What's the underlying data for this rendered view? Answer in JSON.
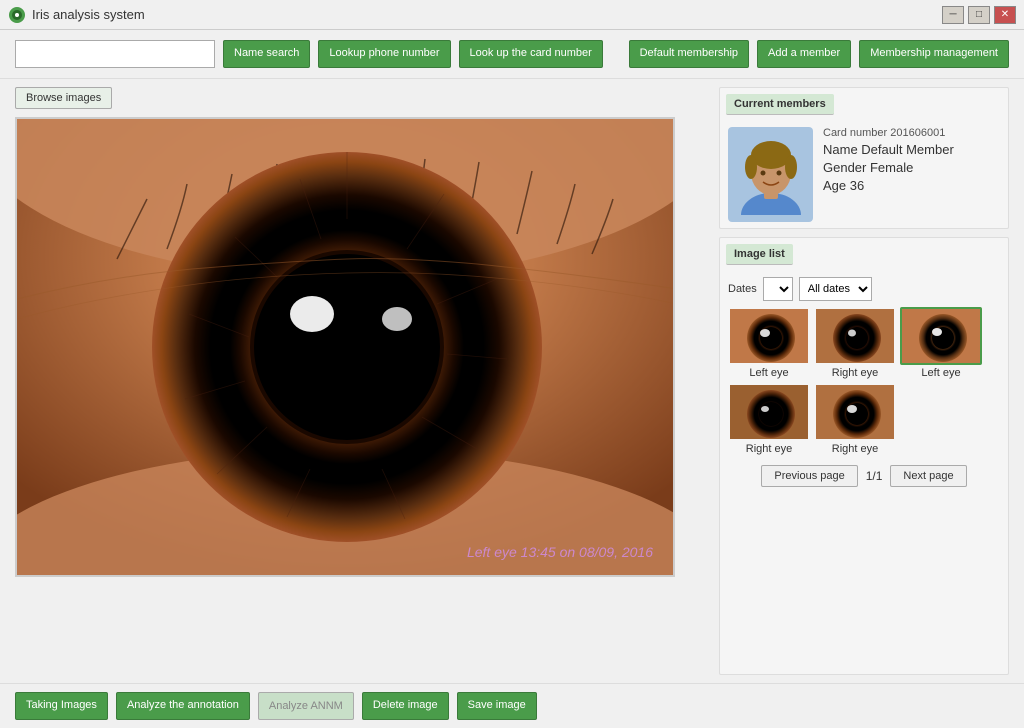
{
  "window": {
    "title": "Iris analysis system",
    "controls": {
      "minimize": "─",
      "maximize": "□",
      "close": "✕"
    }
  },
  "toolbar": {
    "search_placeholder": "",
    "name_search": "Name search",
    "lookup_phone": "Lookup phone number",
    "lookup_card": "Look up the card number",
    "default_membership": "Default membership",
    "add_member": "Add a member",
    "membership_management": "Membership management"
  },
  "browse": {
    "label": "Browse images"
  },
  "image": {
    "label": "Left eye 13:45 on 08/09, 2016"
  },
  "bottom_toolbar": {
    "taking_images": "Taking Images",
    "analyze": "Analyze the annotation",
    "analyze_disabled": "Analyze ANNM",
    "delete": "Delete image",
    "save": "Save image"
  },
  "right_panel": {
    "current_members_label": "Current members",
    "member": {
      "card_number": "Card number 201606001",
      "name_label": "Name Default Member",
      "gender_label": "Gender Female",
      "age_label": "Age 36"
    },
    "image_list_label": "Image list",
    "dates_label": "Dates",
    "dates_select_value": "",
    "all_dates_value": "All dates",
    "thumbnails": [
      {
        "label": "Left eye",
        "selected": false,
        "id": "thumb-1"
      },
      {
        "label": "Right eye",
        "selected": false,
        "id": "thumb-2"
      },
      {
        "label": "Left eye",
        "selected": true,
        "id": "thumb-3"
      },
      {
        "label": "Right eye",
        "selected": false,
        "id": "thumb-4"
      },
      {
        "label": "Right eye",
        "selected": false,
        "id": "thumb-5"
      }
    ],
    "pagination": {
      "previous": "Previous page",
      "page_info": "1/1",
      "next": "Next page"
    }
  }
}
